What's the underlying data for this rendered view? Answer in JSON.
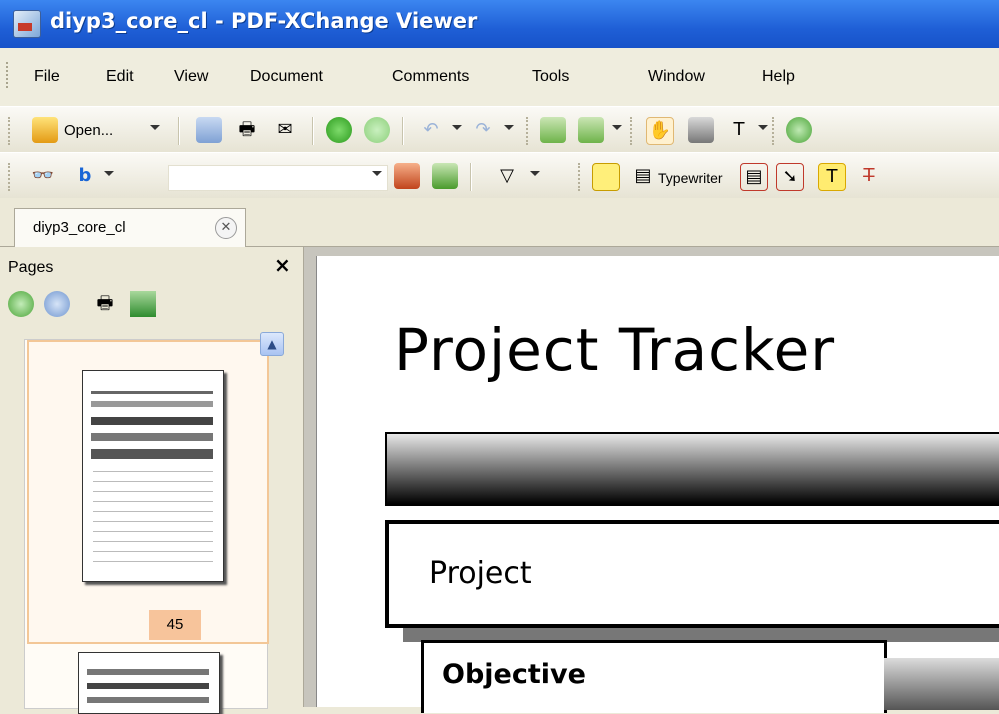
{
  "window": {
    "title": "diyp3_core_cl - PDF-XChange Viewer"
  },
  "menu": {
    "items": [
      "File",
      "Edit",
      "View",
      "Document",
      "Comments",
      "Tools",
      "Window",
      "Help"
    ]
  },
  "toolbar1": {
    "open_label": "Open...",
    "icons": [
      "open-folder-icon",
      "save-icon",
      "print-icon",
      "email-icon",
      "back-icon",
      "forward-icon",
      "undo-icon",
      "redo-icon",
      "rotate-left-icon",
      "rotate-right-icon",
      "hand-tool-icon",
      "snapshot-icon",
      "select-text-icon",
      "zoom-in-icon"
    ]
  },
  "toolbar2": {
    "typewriter_label": "Typewriter",
    "search_value": "",
    "icons": [
      "binoculars-icon",
      "bing-icon",
      "find-previous-icon",
      "find-next-icon",
      "highlight-filter-icon",
      "sticky-note-icon",
      "typewriter-icon",
      "text-box-icon",
      "callout-icon",
      "text-highlight-icon",
      "strikeout-icon"
    ]
  },
  "tabs": [
    {
      "label": "diyp3_core_cl"
    }
  ],
  "pages_panel": {
    "title": "Pages",
    "close": "×",
    "current_page": "45",
    "tools": [
      "zoom-in-icon",
      "zoom-out-icon",
      "print-icon",
      "extract-icon"
    ]
  },
  "document": {
    "title": "Project Tracker",
    "project_label": "Project",
    "objective_label": "Objective"
  },
  "colors": {
    "titlebar": "#2463d8",
    "page_number_badge": "#f7c49b",
    "selected_thumb_border": "#f3c797"
  }
}
